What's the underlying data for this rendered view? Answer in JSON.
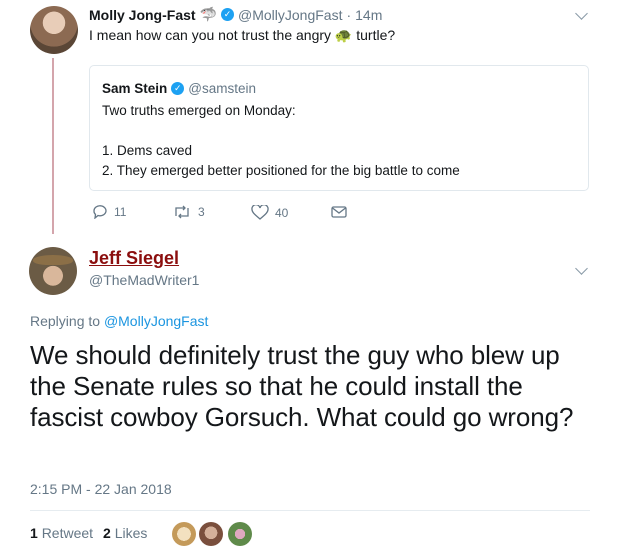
{
  "parent": {
    "name": "Molly Jong-Fast",
    "name_emoji": "🦈",
    "handle": "@MollyJongFast",
    "separator": "·",
    "time": "14m",
    "text_before": "I mean how can you not trust the angry",
    "text_emoji": "🐢",
    "text_after": "turtle?",
    "quote": {
      "name": "Sam Stein",
      "handle": "@samstein",
      "lines": [
        "Two truths emerged on Monday:",
        "1. Dems caved",
        "2. They emerged better positioned for the big battle to come"
      ]
    },
    "actions": {
      "replies": "11",
      "retweets": "3",
      "likes": "40"
    }
  },
  "main": {
    "name": "Jeff Siegel",
    "handle": "@TheMadWriter1",
    "replying_prefix": "Replying to",
    "replying_handle": "@MollyJongFast",
    "text": "We should definitely trust the guy who blew up the Senate rules so that he could install the fascist cowboy Gorsuch. What could go wrong?",
    "timestamp": "2:15 PM - 22 Jan 2018",
    "retweets_count": "1",
    "retweets_label": "Retweet",
    "likes_count": "2",
    "likes_label": "Likes"
  },
  "colors": {
    "thread_line": "#d4a5ac",
    "link": "#1b95e0",
    "jeff_name": "#8b0e0e",
    "verified": "#1da1f2"
  }
}
